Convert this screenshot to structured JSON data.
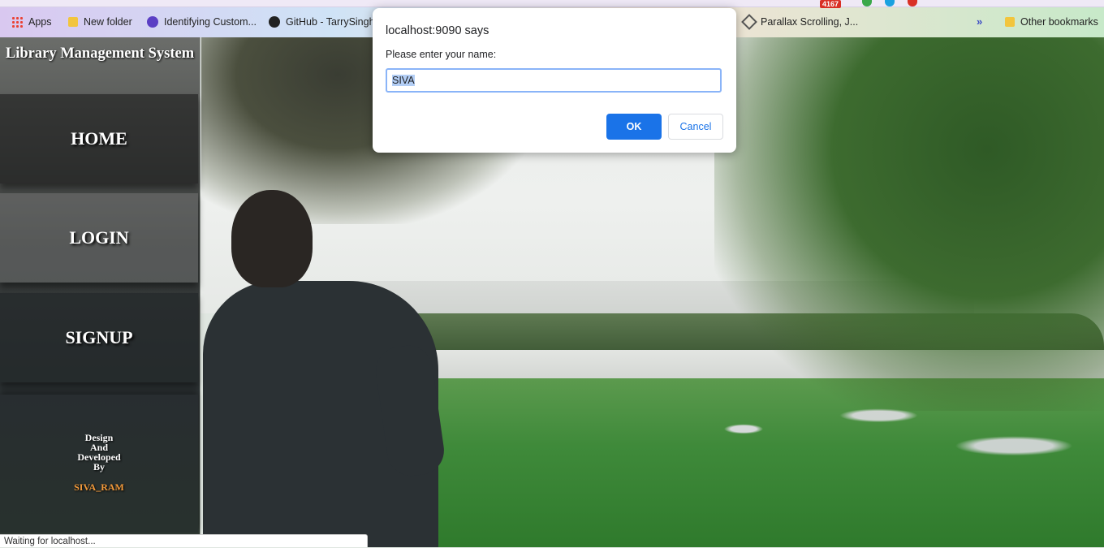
{
  "bookmarks": {
    "items": [
      {
        "label": "Apps",
        "icon": "apps-grid-icon"
      },
      {
        "label": "New folder",
        "icon": "folder-icon"
      },
      {
        "label": "Identifying Custom...",
        "icon": "site-icon"
      },
      {
        "label": "GitHub - TarrySingh...",
        "icon": "github-icon"
      },
      {
        "label": "Parallax Scrolling, J...",
        "icon": "codepen-icon"
      }
    ],
    "overflow_label": "»",
    "other_label": "Other bookmarks",
    "badge_count": "4167"
  },
  "sidebar": {
    "title": "Library Management System",
    "nav": {
      "home": "HOME",
      "login": "LOGIN",
      "signup": "SIGNUP"
    },
    "credit": {
      "line1": "Design",
      "line2": "And",
      "line3": "Developed",
      "line4": "By",
      "author": "SIVA_RAM"
    }
  },
  "dialog": {
    "title": "localhost:9090 says",
    "message": "Please enter your name:",
    "input_value": "SIVA",
    "ok_label": "OK",
    "cancel_label": "Cancel"
  },
  "status": {
    "text": "Waiting for localhost..."
  },
  "colors": {
    "accent": "#1a73e8",
    "author": "#f39a3a"
  }
}
